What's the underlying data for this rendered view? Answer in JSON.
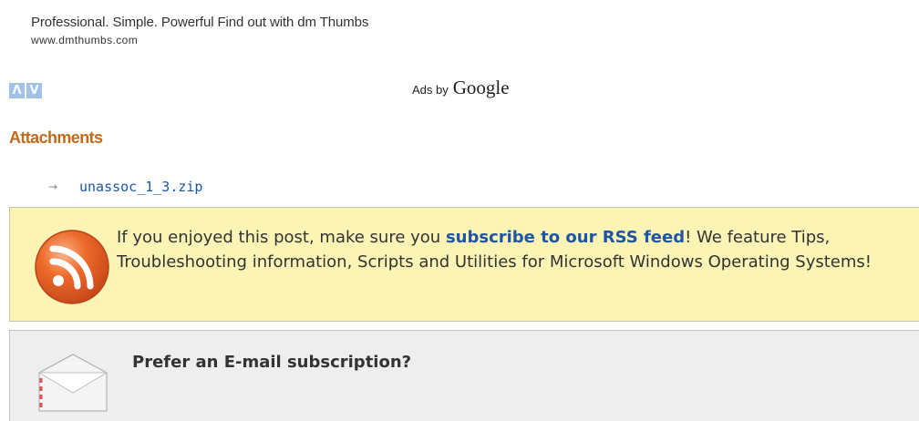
{
  "ad": {
    "title": "Professional. Simple. Powerful Find out with dm Thumbs",
    "url": "www.dmthumbs.com"
  },
  "ad_nav": {
    "prev_label": "Λ",
    "next_label": "V"
  },
  "ads_by": {
    "label": "Ads by",
    "brand": "Google"
  },
  "attachments": {
    "heading": "Attachments",
    "items": [
      {
        "arrow": "→",
        "name": "unassoc_1_3.zip"
      }
    ]
  },
  "rss_promo": {
    "text_before": "If you enjoyed this post, make sure you ",
    "link_text": "subscribe to our RSS feed",
    "text_after": "! We feature Tips, Troubleshooting information, Scripts and Utilities for Microsoft Windows Operating Systems!",
    "icon": "rss-icon"
  },
  "email_promo": {
    "title": "Prefer an E-mail subscription?",
    "icon": "envelope-icon"
  },
  "colors": {
    "heading_orange": "#c06a1a",
    "link_blue": "#1f55a4",
    "rss_box_bg": "#fbf4b5",
    "email_box_bg": "#eeeeee"
  }
}
